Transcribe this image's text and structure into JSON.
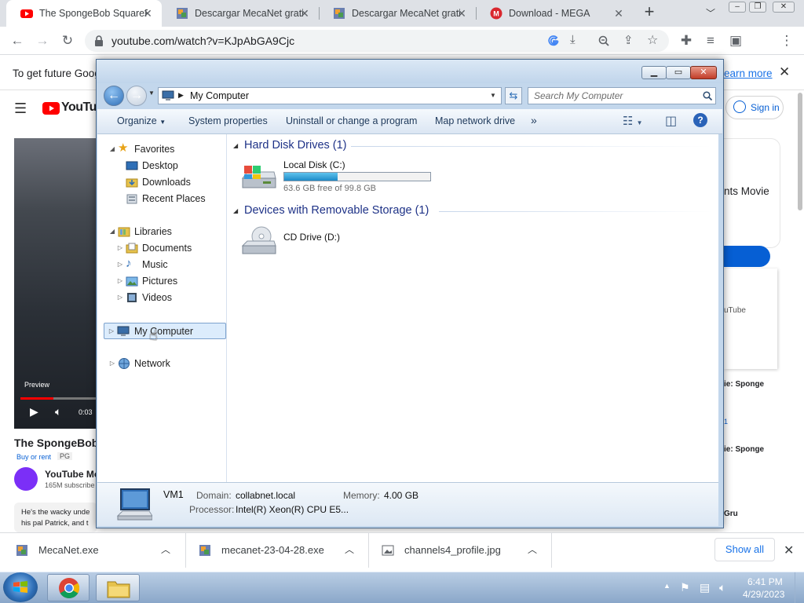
{
  "browser": {
    "tabs": [
      {
        "title": "The SpongeBob SquarePants",
        "favicon": "youtube-icon"
      },
      {
        "title": "Descargar MecaNet gratis",
        "favicon": "mecanet-icon"
      },
      {
        "title": "Descargar MecaNet gratis",
        "favicon": "mecanet-icon"
      },
      {
        "title": "Download - MEGA",
        "favicon": "mega-icon"
      }
    ],
    "new_tab": "+",
    "url": "youtube.com/watch?v=KJpAbGA9Cjc"
  },
  "youtube": {
    "infobar_text": "To get future Goog",
    "learn_more": "earn more",
    "logo": "YouTube",
    "sign_in": "Sign in",
    "preview": "Preview",
    "time": "0:03",
    "title": "The SpongeBob",
    "buy_or_rent": "Buy or rent",
    "rating": "PG",
    "channel": "YouTube Mo",
    "subscribers": "165M subscribe",
    "desc_line1": "He's the wacky unde",
    "desc_line2": "his pal Patrick, and t",
    "side_text1": "nts Movie",
    "side_text2": "uTube",
    "side_text3": "ie: Sponge",
    "side_text4": "1",
    "side_text5": "ie: Sponge",
    "side_text6": "Gru"
  },
  "explorer": {
    "address": "My Computer",
    "search_placeholder": "Search My Computer",
    "commands": [
      "Organize",
      "System properties",
      "Uninstall or change a program",
      "Map network drive",
      "»"
    ],
    "nav": {
      "favorites": "Favorites",
      "desktop": "Desktop",
      "downloads": "Downloads",
      "recent": "Recent Places",
      "libraries": "Libraries",
      "documents": "Documents",
      "music": "Music",
      "pictures": "Pictures",
      "videos": "Videos",
      "computer": "My Computer",
      "network": "Network"
    },
    "groups": {
      "hdd": "Hard Disk Drives (1)",
      "removable": "Devices with Removable Storage (1)"
    },
    "drives": {
      "c_name": "Local Disk (C:)",
      "c_free": "63.6 GB free of 99.8 GB",
      "c_used_fraction": 0.363,
      "d_name": "CD Drive (D:)"
    },
    "details": {
      "name": "VM1",
      "domain_label": "Domain:",
      "domain": "collabnet.local",
      "memory_label": "Memory:",
      "memory": "4.00 GB",
      "processor_label": "Processor:",
      "processor": "Intel(R) Xeon(R) CPU E5..."
    }
  },
  "downloads": {
    "items": [
      "MecaNet.exe",
      "mecanet-23-04-28.exe",
      "channels4_profile.jpg"
    ],
    "show_all": "Show all"
  },
  "taskbar": {
    "time": "6:41 PM",
    "date": "4/29/2023"
  },
  "colors": {
    "accent_blue": "#065fd4",
    "youtube_red": "#ff0000",
    "drive_bar": "#26a0da"
  }
}
